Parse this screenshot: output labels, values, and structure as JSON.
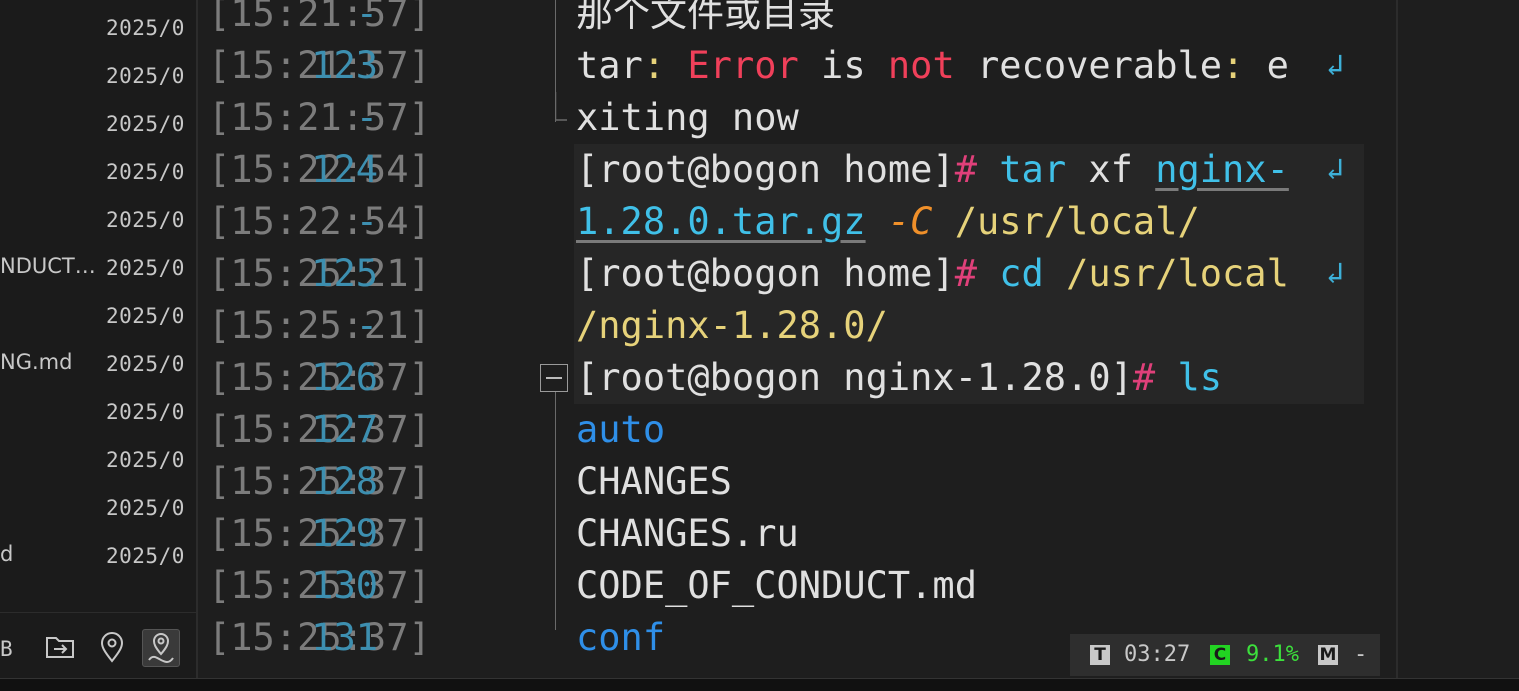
{
  "file_panel": {
    "files": [
      {
        "name": "",
        "date": "2025/0"
      },
      {
        "name": "",
        "date": "2025/0"
      },
      {
        "name": "",
        "date": "2025/0"
      },
      {
        "name": "",
        "date": "2025/0"
      },
      {
        "name": "",
        "date": "2025/0"
      },
      {
        "name": "NDUCT…",
        "date": "2025/0"
      },
      {
        "name": "",
        "date": "2025/0"
      },
      {
        "name": "NG.md",
        "date": "2025/0"
      },
      {
        "name": "",
        "date": "2025/0"
      },
      {
        "name": "",
        "date": "2025/0"
      },
      {
        "name": "",
        "date": "2025/0"
      },
      {
        "name": "d",
        "date": "2025/0"
      }
    ],
    "toolbar": {
      "size_suffix": "B",
      "icons": [
        "folder-arrow-icon",
        "location-pin-icon",
        "route-pin-icon"
      ]
    }
  },
  "terminal": {
    "lines": [
      {
        "ts": "[15:21:57]",
        "ln": "-",
        "segments": [
          {
            "t": "那个文件或目录",
            "c": "w"
          }
        ]
      },
      {
        "ts": "[15:21:57]",
        "ln": "123",
        "wrap": true,
        "segments": [
          {
            "t": "tar",
            "c": "w"
          },
          {
            "t": ": ",
            "c": "yel"
          },
          {
            "t": "Error",
            "c": "red"
          },
          {
            "t": " is ",
            "c": "w"
          },
          {
            "t": "not",
            "c": "red"
          },
          {
            "t": " recoverable",
            "c": "w"
          },
          {
            "t": ": ",
            "c": "yel"
          },
          {
            "t": "e",
            "c": "w"
          }
        ]
      },
      {
        "ts": "[15:21:57]",
        "ln": "-",
        "segments": [
          {
            "t": "xiting now",
            "c": "w"
          }
        ]
      },
      {
        "ts": "[15:22:54]",
        "ln": "124",
        "hl": true,
        "wrap": true,
        "segments": [
          {
            "t": "[root@bogon home]",
            "c": "w"
          },
          {
            "t": "# ",
            "c": "pink"
          },
          {
            "t": "tar",
            "c": "cyan"
          },
          {
            "t": " xf ",
            "c": "w"
          },
          {
            "t": "nginx-",
            "c": "cyan u"
          }
        ]
      },
      {
        "ts": "[15:22:54]",
        "ln": "-",
        "hl": true,
        "segments": [
          {
            "t": "1.28.0.tar.gz",
            "c": "cyan u"
          },
          {
            "t": "  ",
            "c": "w"
          },
          {
            "t": "-C",
            "c": "org"
          },
          {
            "t": " /usr/local/",
            "c": "yel"
          }
        ]
      },
      {
        "ts": "[15:25:21]",
        "ln": "125",
        "hl": true,
        "wrap": true,
        "segments": [
          {
            "t": "[root@bogon home]",
            "c": "w"
          },
          {
            "t": "# ",
            "c": "pink"
          },
          {
            "t": "cd",
            "c": "cyan"
          },
          {
            "t": " /usr/local",
            "c": "yel"
          }
        ]
      },
      {
        "ts": "[15:25:21]",
        "ln": "-",
        "hl": true,
        "segments": [
          {
            "t": "/nginx-1.28.0/",
            "c": "yel"
          }
        ]
      },
      {
        "ts": "[15:25:37]",
        "ln": "126",
        "hl": true,
        "segments": [
          {
            "t": "[root@bogon nginx-1.28.0]",
            "c": "w"
          },
          {
            "t": "# ",
            "c": "pink"
          },
          {
            "t": "ls",
            "c": "cyan"
          }
        ]
      },
      {
        "ts": "[15:25:37]",
        "ln": "127",
        "segments": [
          {
            "t": "auto",
            "c": "blue"
          }
        ]
      },
      {
        "ts": "[15:25:37]",
        "ln": "128",
        "segments": [
          {
            "t": "CHANGES",
            "c": "w"
          }
        ]
      },
      {
        "ts": "[15:25:37]",
        "ln": "129",
        "segments": [
          {
            "t": "CHANGES.ru",
            "c": "w"
          }
        ]
      },
      {
        "ts": "[15:25:37]",
        "ln": "130",
        "segments": [
          {
            "t": "CODE_OF_CONDUCT.md",
            "c": "w"
          }
        ]
      },
      {
        "ts": "[15:25:37]",
        "ln": "131",
        "segments": [
          {
            "t": "conf",
            "c": "blue"
          }
        ]
      }
    ]
  },
  "status": {
    "t_badge": "T",
    "time": "03:27",
    "c_badge": "C",
    "cpu": "9.1%",
    "m_badge": "M",
    "mem": "-",
    "colors": {
      "c_badge_bg": "#22d422",
      "cpu_text": "#3ce03c",
      "t_badge_bg": "#c8c8c8"
    }
  }
}
